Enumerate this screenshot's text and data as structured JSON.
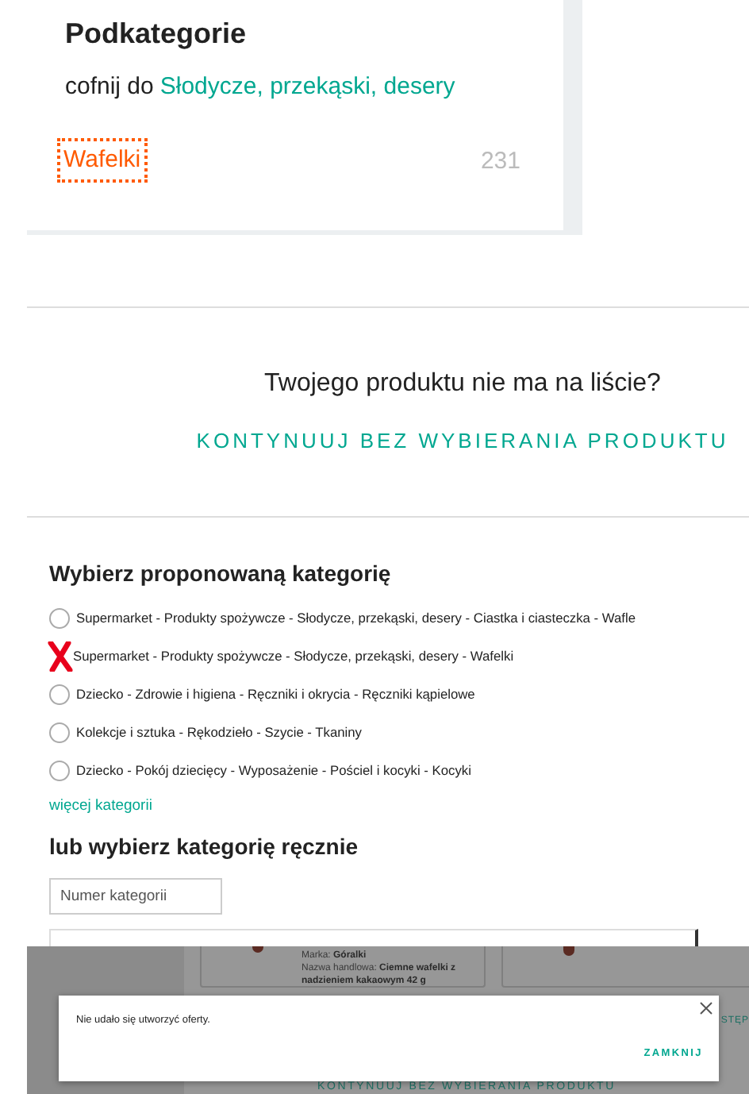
{
  "subcategories": {
    "title": "Podkategorie",
    "back_prefix": "cofnij do",
    "back_link": "Słodycze, przekąski, desery",
    "items": [
      {
        "label": "Wafelki",
        "count": "231",
        "focused": true
      }
    ]
  },
  "no_product": {
    "question": "Twojego produktu nie ma na liście?",
    "continue_button": "KONTYNUUJ BEZ WYBIERANIA PRODUKTU"
  },
  "suggested": {
    "title": "Wybierz proponowaną kategorię",
    "options": [
      {
        "label": "Supermarket - Produkty spożywcze - Słodycze, przekąski, desery - Ciastka i ciasteczka - Wafle",
        "selected": false,
        "crossed_out": false
      },
      {
        "label": "Supermarket - Produkty spożywcze - Słodycze, przekąski, desery - Wafelki",
        "selected": false,
        "crossed_out": true
      },
      {
        "label": "Dziecko - Zdrowie i higiena - Ręczniki i okrycia - Ręczniki kąpielowe",
        "selected": false,
        "crossed_out": false
      },
      {
        "label": "Kolekcje i sztuka - Rękodzieło - Szycie - Tkaniny",
        "selected": false,
        "crossed_out": false
      },
      {
        "label": "Dziecko - Pokój dziecięcy - Wyposażenie - Pościel i kocyki - Kocyki",
        "selected": false,
        "crossed_out": false
      }
    ],
    "more_link": "więcej kategorii"
  },
  "manual": {
    "title": "lub wybierz kategorię ręcznie",
    "placeholder": "Numer kategorii"
  },
  "background": {
    "product_card_lines": [
      "Marka: **Góralki**",
      "Nazwa handlowa: **Ciemne wafelki z nadzieniem kakaowym 42 g**"
    ],
    "partial_button": "STĘP",
    "continue_button": "KONTYNUUJ BEZ WYBIERANIA PRODUKTU"
  },
  "dialog": {
    "message": "Nie udało się utworzyć oferty.",
    "close_button": "ZAMKNIJ"
  }
}
